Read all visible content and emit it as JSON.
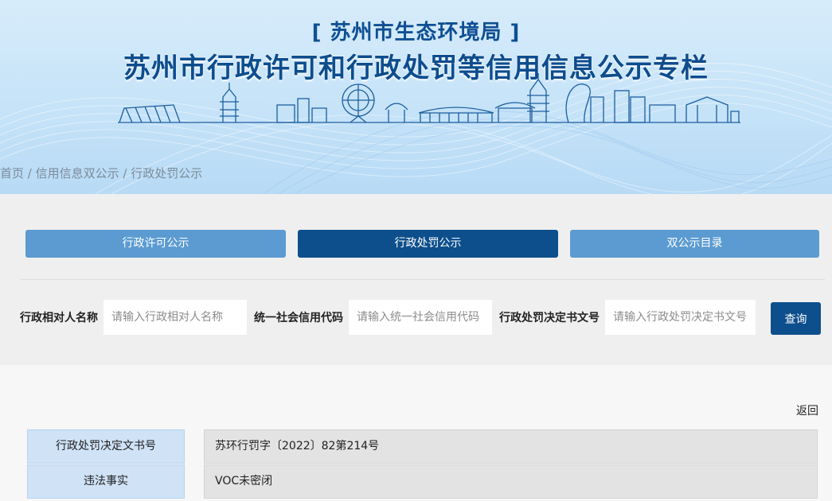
{
  "header": {
    "agency": "[ 苏州市生态环境局 ]",
    "title": "苏州市行政许可和行政处罚等信用信息公示专栏"
  },
  "breadcrumb": {
    "items": [
      "首页",
      "信用信息双公示",
      "行政处罚公示"
    ],
    "separator": " / "
  },
  "tabs": [
    {
      "label": "行政许可公示",
      "active": false
    },
    {
      "label": "行政处罚公示",
      "active": true
    },
    {
      "label": "双公示目录",
      "active": false
    }
  ],
  "search": {
    "fields": [
      {
        "label": "行政相对人名称",
        "placeholder": "请输入行政相对人名称",
        "value": ""
      },
      {
        "label": "统一社会信用代码",
        "placeholder": "请输入统一社会信用代码",
        "value": ""
      },
      {
        "label": "行政处罚决定书文号",
        "placeholder": "请输入行政处罚决定书文号",
        "value": ""
      }
    ],
    "button_label": "查询"
  },
  "detail": {
    "back_label": "返回",
    "rows": [
      {
        "label": "行政处罚决定文书号",
        "value": "苏环行罚字〔2022〕82第214号"
      },
      {
        "label": "违法事实",
        "value": "VOC未密闭"
      }
    ]
  },
  "colors": {
    "primary": "#0d4f8c",
    "tab_inactive": "#5b9bd1",
    "banner_bg": "#c6e3f8",
    "label_bg": "#cfe2f6",
    "value_bg": "#e3e3e3"
  }
}
